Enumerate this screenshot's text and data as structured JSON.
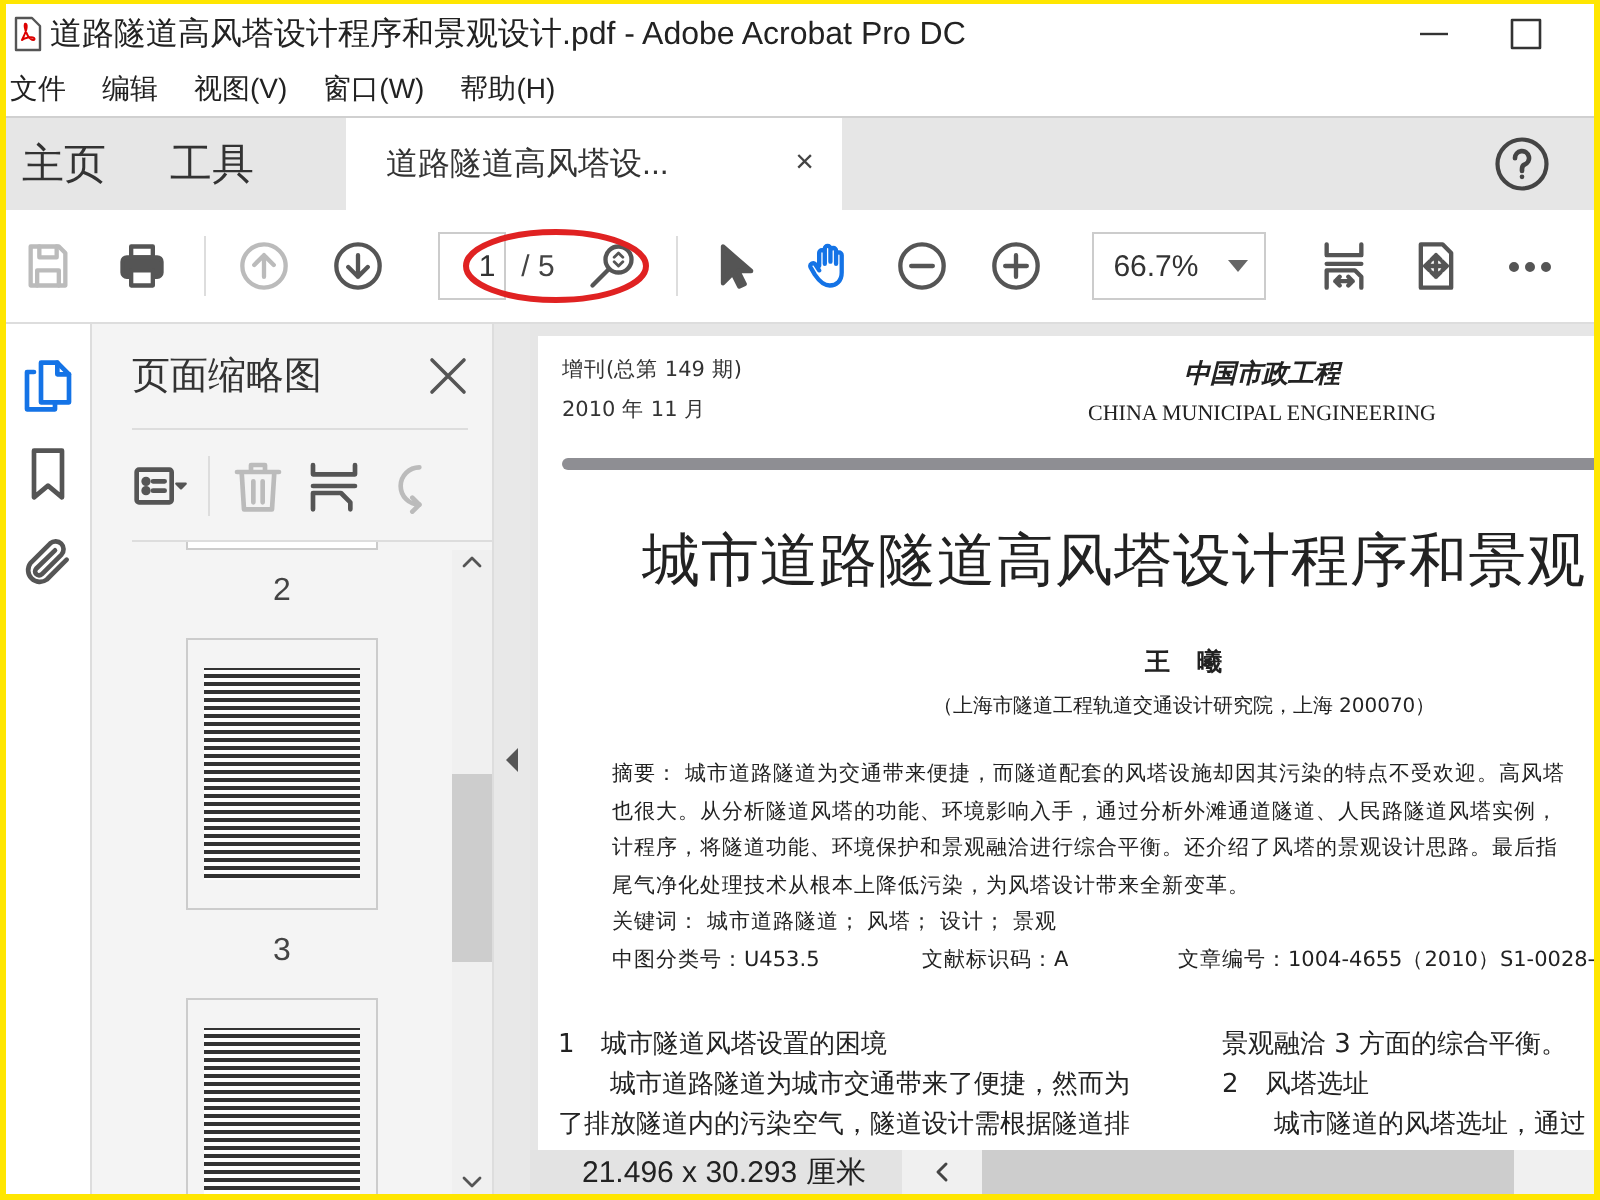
{
  "window": {
    "title": "道路隧道高风塔设计程序和景观设计.pdf - Adobe Acrobat Pro DC"
  },
  "menu": [
    {
      "label": "文件"
    },
    {
      "label": "编辑"
    },
    {
      "label": "视图(V)"
    },
    {
      "label": "窗口(W)"
    },
    {
      "label": "帮助(H)"
    }
  ],
  "tabs": [
    {
      "label": "主页",
      "kind": "nav",
      "selected": false
    },
    {
      "label": "工具",
      "kind": "nav",
      "selected": false
    },
    {
      "label": "道路隧道高风塔设...",
      "kind": "document",
      "selected": true,
      "close": "×"
    }
  ],
  "toolbar": {
    "left": [
      {
        "kind": "save",
        "disabled": true
      },
      {
        "kind": "print",
        "disabled": false
      },
      {
        "kind": "prev-page",
        "disabled": true
      },
      {
        "kind": "next-page",
        "disabled": false
      }
    ],
    "page": {
      "value": "1",
      "total": "/ 5"
    },
    "tools": [
      {
        "kind": "pointer",
        "selected": false
      },
      {
        "kind": "hand",
        "selected": true
      }
    ],
    "zoom_buttons": [
      {
        "kind": "zoom-out"
      },
      {
        "kind": "zoom-in"
      }
    ],
    "zoom": {
      "value": "66.7%"
    },
    "right": [
      {
        "kind": "fit-width"
      },
      {
        "kind": "full-screen"
      },
      {
        "kind": "more"
      }
    ]
  },
  "sidebar": {
    "items": [
      {
        "kind": "pages",
        "selected": true
      },
      {
        "kind": "bookmarks",
        "selected": false
      },
      {
        "kind": "attachments",
        "selected": false
      }
    ]
  },
  "panel": {
    "title": "页面缩略图",
    "buttons": [
      {
        "kind": "options",
        "disabled": false
      },
      {
        "kind": "delete",
        "disabled": true
      },
      {
        "kind": "insert",
        "disabled": false
      },
      {
        "kind": "rotate",
        "disabled": true
      }
    ],
    "page_labels": [
      "2",
      "3"
    ]
  },
  "document": {
    "issue": "增刊(总第 149 期)",
    "date": "2010 年 11 月",
    "journal_cn": "中国市政工程",
    "journal_en": "CHINA MUNICIPAL ENGINEERING",
    "title": "城市道路隧道高风塔设计程序和景观",
    "author": "王　曦",
    "affiliation": "（上海市隧道工程轨道交通设计研究院，上海 200070）",
    "abstract_lines": [
      "摘要： 城市道路隧道为交通带来便捷，而隧道配套的风塔设施却因其污染的特点不受欢迎。高风塔",
      "也很大。从分析隧道风塔的功能、环境影响入手，通过分析外滩通道隧道、人民路隧道风塔实例，",
      "计程序，将隧道功能、环境保护和景观融洽进行综合平衡。还介绍了风塔的景观设计思路。最后指",
      "尾气净化处理技术从根本上降低污染，为风塔设计带来全新变革。"
    ],
    "keywords": "关键词： 城市道路隧道； 风塔； 设计； 景观",
    "codes": [
      "中图分类号：U453.5",
      "文献标识码：A",
      "文章编号：1004-4655（2010）S1-0028-"
    ],
    "col_left": [
      {
        "kind": "heading",
        "text": "1　城市隧道风塔设置的困境"
      },
      {
        "kind": "first",
        "text": "城市道路隧道为城市交通带来了便捷，然而为"
      },
      {
        "kind": "line",
        "text": "了排放隧道内的污染空气，隧道设计需根据隧道排"
      }
    ],
    "col_right": [
      {
        "kind": "line",
        "text": "景观融洽 3 方面的综合平衡。"
      },
      {
        "kind": "heading",
        "text": "2　风塔选址"
      },
      {
        "kind": "first",
        "text": "城市隧道的风塔选址，通过"
      }
    ]
  },
  "status_bar": {
    "page_size": "21.496 x 30.293 厘米"
  }
}
